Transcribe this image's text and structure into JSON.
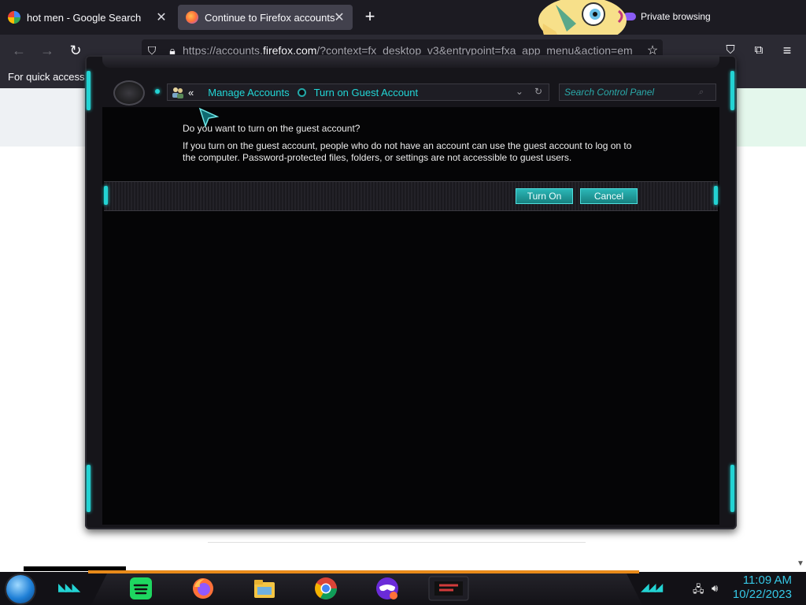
{
  "browser": {
    "tabs": [
      {
        "title": "hot men - Google Search",
        "active": false
      },
      {
        "title": "Continue to Firefox accounts",
        "active": true
      }
    ],
    "private_label": "Private browsing",
    "url": {
      "prefix": "https://accounts.",
      "host": "firefox.com",
      "rest": "/?context=fx_desktop_v3&entrypoint=fxa_app_menu&action=em"
    },
    "bookmark_hint": "For quick access, p"
  },
  "control_panel": {
    "breadcrumb": [
      "Manage Accounts",
      "Turn on Guest Account"
    ],
    "search_placeholder": "Search Control Panel",
    "question": "Do you want to turn on the guest account?",
    "description": "If you turn on the guest account, people who do not have an account can use the guest account to log on to the computer. Password-protected files, folders, or settings are not accessible to guest users.",
    "buttons": {
      "turn_on": "Turn On",
      "cancel": "Cancel"
    },
    "accent_color": "#23d3d3"
  },
  "taskbar": {
    "time": "11:09 AM",
    "date": "10/22/2023",
    "apps": [
      "spotify-icon",
      "firefox-icon",
      "file-explorer-icon",
      "chrome-icon",
      "private-browsing-icon",
      "control-panel-icon"
    ]
  }
}
